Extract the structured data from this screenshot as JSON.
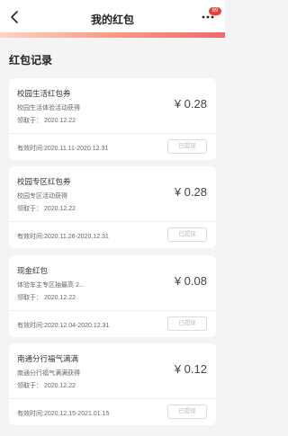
{
  "header": {
    "title": "我的红包",
    "badge_count": "89",
    "back_icon": "chevron-left-icon",
    "more_icon": "more-dots-icon"
  },
  "section_title": "红包记录",
  "cards": [
    {
      "name": "校园生活红包券",
      "desc": "校园生活体验活动获得",
      "received": "领取于： 2020.12.22",
      "amount": "¥ 0.28",
      "validity": "有效时间:2020.11.11-2020.12.31",
      "status": "已提现"
    },
    {
      "name": "校园专区红包券",
      "desc": "校园专区活动获得",
      "received": "领取于： 2020.12.22",
      "amount": "¥ 0.28",
      "validity": "有效时间:2020.11.26-2020.12.31",
      "status": "已提现"
    },
    {
      "name": "现金红包",
      "desc": "体验车主专区抽最高 2...",
      "received": "领取于： 2020.12.22",
      "amount": "¥ 0.08",
      "validity": "有效时间:2020.12.04-2020.12.31",
      "status": "已提现"
    },
    {
      "name": "南通分行福气满满",
      "desc": "南通分行福气满满获得",
      "received": "领取于： 2020.12.22",
      "amount": "¥ 0.12",
      "validity": "有效时间:2020.12.15-2021.01.15",
      "status": "已提现"
    }
  ],
  "colors": {
    "accent": "#e8413a",
    "background": "#f4f4f4",
    "card": "#ffffff"
  }
}
